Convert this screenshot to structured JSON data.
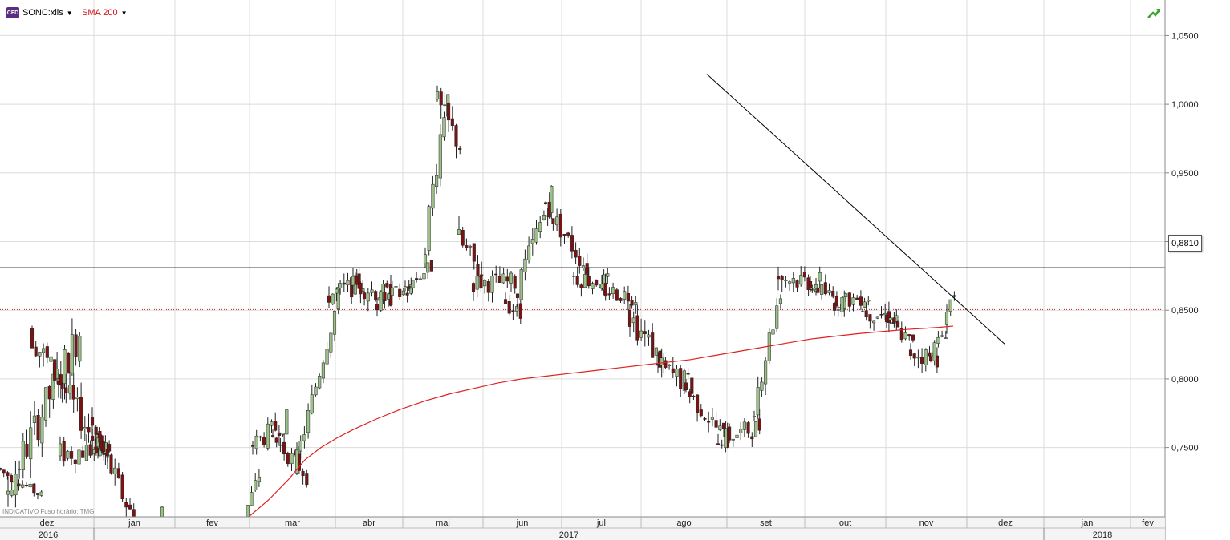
{
  "header": {
    "icon_text": "CFD",
    "symbol": "SONC:xlis",
    "indicator": "SMA 200"
  },
  "price_tag": "0,8810",
  "footnote": "INDICATIVO   Fuso horário: TMG",
  "colors": {
    "up_candle": "#9bc088",
    "down_candle": "#7a1414",
    "sma": "#e02020",
    "hline": "#000000",
    "dotted_line": "#c02020",
    "grid": "#dcdcdc"
  },
  "chart_data": {
    "type": "candlestick",
    "y_axis_ticks": [
      "1,0500",
      "1,0000",
      "0,9500",
      "0,9000",
      "0,8500",
      "0,8000",
      "0,7500"
    ],
    "y_tick_values": [
      1.05,
      1.0,
      0.95,
      0.9,
      0.85,
      0.8,
      0.75
    ],
    "ylim": [
      0.6996,
      1.0759
    ],
    "months": [
      "dez",
      "jan",
      "fev",
      "mar",
      "abr",
      "mai",
      "jun",
      "jul",
      "ago",
      "set",
      "out",
      "nov",
      "dez",
      "jan",
      "fev"
    ],
    "years": [
      "2016",
      "2017",
      "2018"
    ],
    "horizontal_line": 0.881,
    "dotted_line": 0.8505,
    "trendline": [
      [
        0.881,
        1.0219
      ],
      [
        1.252,
        0.8255
      ]
    ],
    "sma200": [
      [
        0.31,
        0.6996
      ],
      [
        0.335,
        0.712
      ],
      [
        0.36,
        0.727
      ],
      [
        0.38,
        0.741
      ],
      [
        0.4,
        0.75
      ],
      [
        0.42,
        0.757
      ],
      [
        0.44,
        0.763
      ],
      [
        0.47,
        0.771
      ],
      [
        0.5,
        0.778
      ],
      [
        0.53,
        0.784
      ],
      [
        0.56,
        0.789
      ],
      [
        0.59,
        0.793
      ],
      [
        0.62,
        0.797
      ],
      [
        0.65,
        0.8
      ],
      [
        0.68,
        0.802
      ],
      [
        0.71,
        0.804
      ],
      [
        0.74,
        0.806
      ],
      [
        0.77,
        0.808
      ],
      [
        0.8,
        0.81
      ],
      [
        0.83,
        0.812
      ],
      [
        0.86,
        0.814
      ],
      [
        0.89,
        0.817
      ],
      [
        0.92,
        0.82
      ],
      [
        0.95,
        0.823
      ],
      [
        0.98,
        0.826
      ],
      [
        1.01,
        0.829
      ],
      [
        1.04,
        0.831
      ],
      [
        1.07,
        0.833
      ],
      [
        1.1,
        0.8345
      ],
      [
        1.13,
        0.836
      ],
      [
        1.17,
        0.8375
      ],
      [
        1.188,
        0.8385
      ]
    ],
    "segments": [
      [
        0.0,
        0.735,
        0.715,
        0.007,
        12
      ],
      [
        0.01,
        0.715,
        0.835,
        0.028,
        20
      ],
      [
        0.04,
        0.835,
        0.74,
        0.022,
        21
      ],
      [
        0.075,
        0.745,
        0.75,
        0.018,
        14
      ],
      [
        0.115,
        0.77,
        0.685,
        0.018,
        14
      ],
      [
        0.155,
        0.685,
        0.7,
        0.015,
        11
      ],
      [
        0.215,
        0.67,
        0.67,
        0.008,
        7
      ],
      [
        0.29,
        0.67,
        0.73,
        0.012,
        8
      ],
      [
        0.315,
        0.75,
        0.77,
        0.015,
        10
      ],
      [
        0.34,
        0.76,
        0.73,
        0.014,
        10
      ],
      [
        0.37,
        0.73,
        0.86,
        0.015,
        12
      ],
      [
        0.41,
        0.86,
        0.87,
        0.015,
        10
      ],
      [
        0.44,
        0.87,
        0.86,
        0.016,
        11
      ],
      [
        0.47,
        0.855,
        0.865,
        0.015,
        10
      ],
      [
        0.505,
        0.865,
        0.882,
        0.011,
        8
      ],
      [
        0.53,
        0.882,
        1.015,
        0.022,
        7
      ],
      [
        0.545,
        1.005,
        0.97,
        0.02,
        7
      ],
      [
        0.572,
        0.905,
        0.875,
        0.02,
        7
      ],
      [
        0.59,
        0.87,
        0.87,
        0.015,
        12
      ],
      [
        0.63,
        0.86,
        0.845,
        0.014,
        5
      ],
      [
        0.645,
        0.86,
        0.935,
        0.018,
        10
      ],
      [
        0.68,
        0.93,
        0.88,
        0.015,
        12
      ],
      [
        0.715,
        0.875,
        0.87,
        0.015,
        10
      ],
      [
        0.75,
        0.865,
        0.86,
        0.014,
        10
      ],
      [
        0.785,
        0.85,
        0.81,
        0.02,
        10
      ],
      [
        0.82,
        0.81,
        0.795,
        0.019,
        10
      ],
      [
        0.855,
        0.795,
        0.755,
        0.015,
        12
      ],
      [
        0.895,
        0.755,
        0.765,
        0.015,
        12
      ],
      [
        0.94,
        0.77,
        0.865,
        0.018,
        8
      ],
      [
        0.97,
        0.875,
        0.87,
        0.017,
        12
      ],
      [
        1.01,
        0.87,
        0.855,
        0.012,
        10
      ],
      [
        1.04,
        0.855,
        0.86,
        0.012,
        10
      ],
      [
        1.075,
        0.85,
        0.845,
        0.015,
        10
      ],
      [
        1.105,
        0.845,
        0.825,
        0.012,
        8
      ],
      [
        1.135,
        0.82,
        0.815,
        0.015,
        8
      ],
      [
        1.16,
        0.815,
        0.835,
        0.012,
        5
      ],
      [
        1.18,
        0.84,
        0.865,
        0.015,
        3
      ]
    ]
  }
}
